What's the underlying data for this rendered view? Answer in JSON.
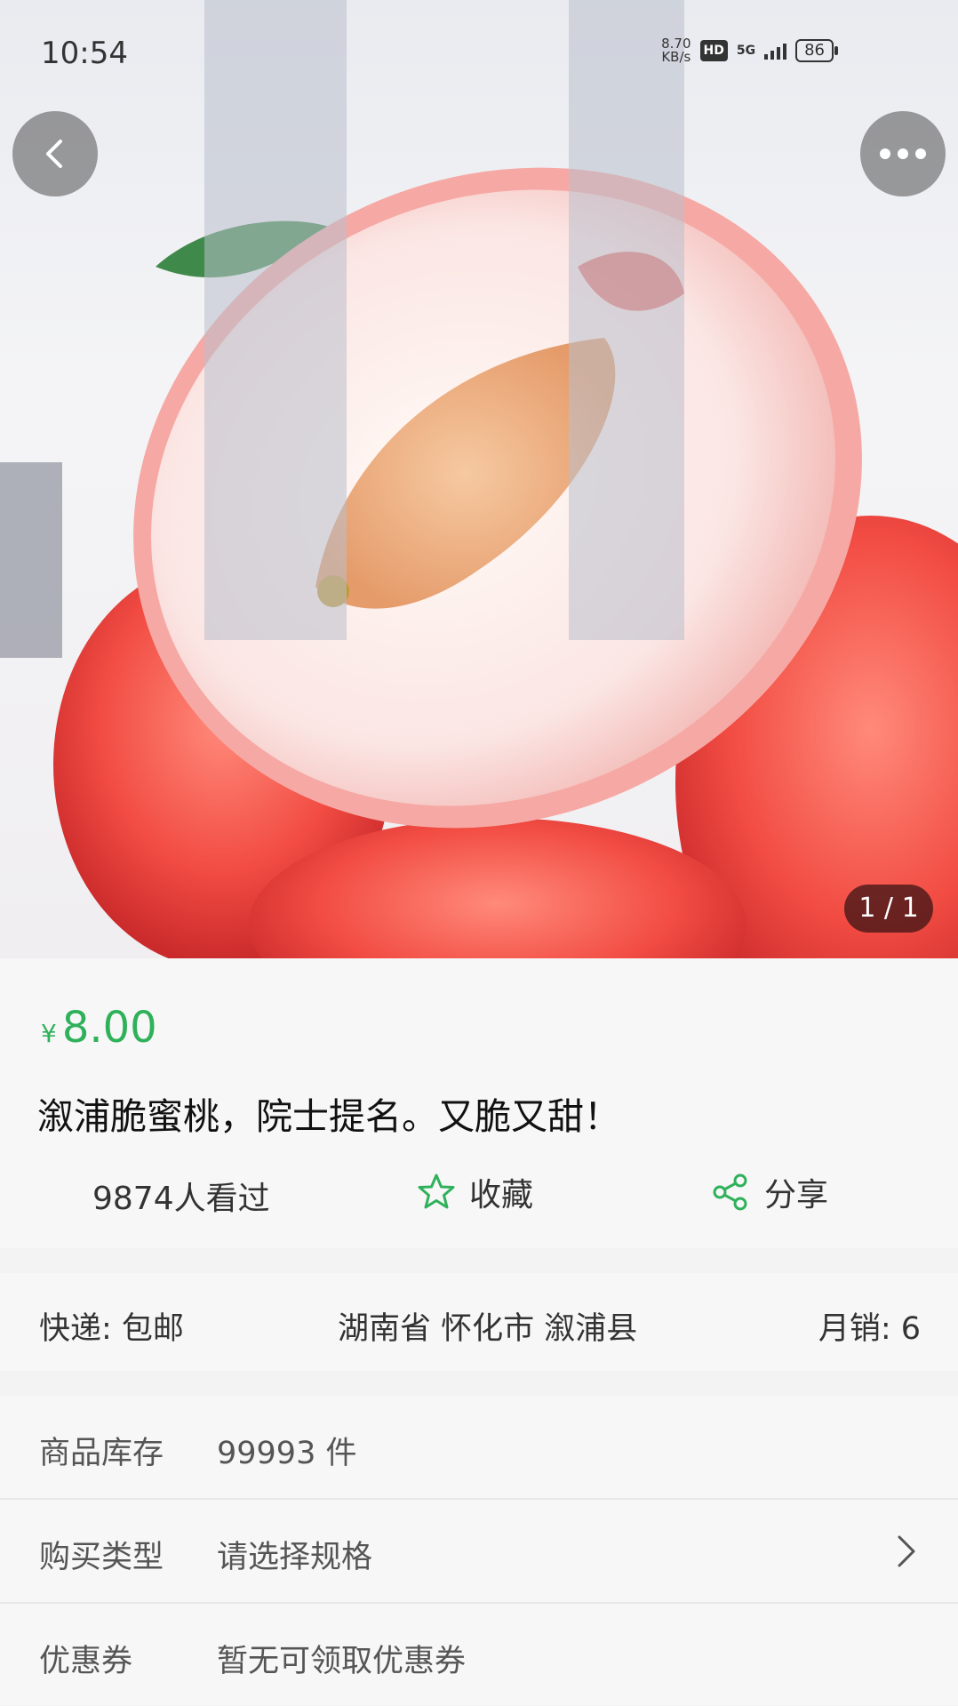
{
  "status_bar": {
    "time": "10:54",
    "net_speed_value": "8.70",
    "net_speed_unit": "KB/s",
    "hd_label": "HD",
    "network_label": "5G",
    "battery": "86"
  },
  "gallery": {
    "image_alt": "product-photo-peach",
    "page_indicator": "1 / 1"
  },
  "product": {
    "currency_symbol": "¥",
    "price": "8.00",
    "title": "溆浦脆蜜桃，院士提名。又脆又甜！",
    "views_text": "9874人看过",
    "favorite_label": "收藏",
    "share_label": "分享",
    "accent_color": "#2fb15a"
  },
  "shipping": {
    "express": "快递: 包邮",
    "location": "湖南省 怀化市 溆浦县",
    "monthly_sales": "月销: 6"
  },
  "details": [
    {
      "label": "商品库存",
      "value": "99993 件"
    },
    {
      "label": "购买类型",
      "value": "请选择规格"
    },
    {
      "label": "优惠券",
      "value": "暂无可领取优惠券"
    }
  ]
}
